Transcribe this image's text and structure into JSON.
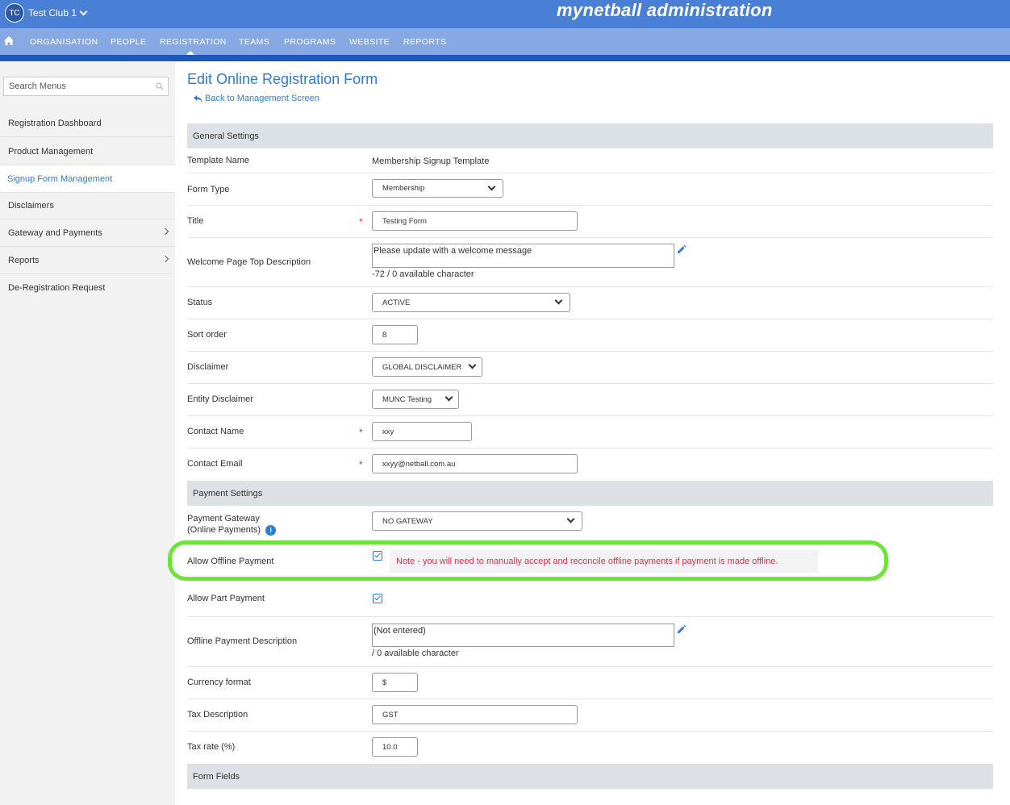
{
  "header": {
    "avatar_initials": "TC",
    "club_name": "Test Club 1",
    "brand": "mynetball administration"
  },
  "nav": {
    "items": [
      "ORGANISATION",
      "PEOPLE",
      "REGISTRATION",
      "TEAMS",
      "PROGRAMS",
      "WEBSITE",
      "REPORTS"
    ],
    "active": "REGISTRATION"
  },
  "sidebar": {
    "search_placeholder": "Search Menus",
    "items": [
      {
        "label": "Registration Dashboard"
      },
      {
        "label": "Product Management"
      },
      {
        "label": "Signup Form Management"
      },
      {
        "label": "Disclaimers"
      },
      {
        "label": "Gateway and Payments"
      },
      {
        "label": "Reports"
      },
      {
        "label": "De-Registration Request"
      }
    ]
  },
  "main": {
    "title": "Edit Online Registration Form",
    "back_link": "Back to Management Screen",
    "general_settings": "General Settings",
    "template_name_label": "Template Name",
    "template_name_value": "Membership Signup Template",
    "form_type_label": "Form Type",
    "form_type_value": "Membership",
    "title_label": "Title",
    "title_value": "Testing Form",
    "welcome_label": "Welcome Page Top Description",
    "welcome_value": "Please update with a welcome message",
    "welcome_counter": "-72 / 0 available character",
    "status_label": "Status",
    "status_value": "ACTIVE",
    "sort_label": "Sort order",
    "sort_value": "8",
    "disclaimer_label": "Disclaimer",
    "disclaimer_value": "GLOBAL DISCLAIMER",
    "entity_disclaimer_label": "Entity Disclaimer",
    "entity_disclaimer_value": "MUNC Testing",
    "contact_name_label": "Contact Name",
    "contact_name_value": "xxy",
    "contact_email_label": "Contact Email",
    "contact_email_value": "xxyy@netball.com.au",
    "payment_settings": "Payment Settings",
    "gateway_label_1": "Payment Gateway",
    "gateway_label_2": "(Online Payments)",
    "gateway_value": "NO GATEWAY",
    "offline_label": "Allow Offline Payment",
    "offline_note": "Note - you will need to manually accept and reconcile offline payments if payment is made offline.",
    "part_label": "Allow Part Payment",
    "offline_desc_label": "Offline Payment Description",
    "offline_desc_value": "(Not entered)",
    "offline_desc_counter": "/ 0 available character",
    "currency_label": "Currency format",
    "currency_value": "$",
    "tax_desc_label": "Tax Description",
    "tax_desc_value": "GST",
    "tax_rate_label": "Tax rate (%)",
    "tax_rate_value": "10.0",
    "form_fields": "Form Fields",
    "required_mark": "*",
    "info_glyph": "i"
  },
  "colors": {
    "topbar": "#4a7fd6",
    "navbar": "#86a8e3",
    "accent": "#2d7bd6",
    "required": "#e0304e",
    "highlight": "#6fe33a"
  }
}
